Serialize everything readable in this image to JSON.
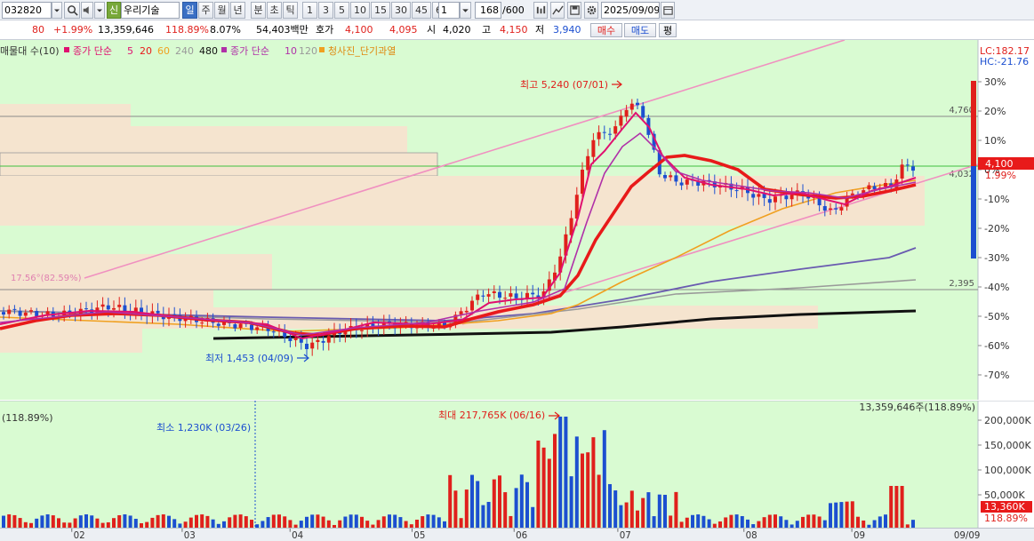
{
  "toolbar": {
    "code": "032820",
    "badge": "신",
    "name": "우리기술",
    "periods": [
      "일",
      "주",
      "월",
      "년",
      "분",
      "초",
      "틱"
    ],
    "numbers": [
      "1",
      "3",
      "5",
      "10",
      "15",
      "30",
      "45",
      "60"
    ],
    "unit": "1",
    "count": "168",
    "count_total": "/600",
    "date": "2025/09/09"
  },
  "quote": {
    "change_abs": "80",
    "change_pct": "+1.99%",
    "volume": "13,359,646",
    "volume_ratio": "118.89%",
    "turnover": "8.07%",
    "amount": "54,403백만",
    "quote_label": "호가",
    "ask": "4,100",
    "bid": "4,095",
    "open_label": "시",
    "open": "4,020",
    "high_label": "고",
    "high": "4,150",
    "low_label": "저",
    "low": "3,940",
    "buy_label": "매수",
    "sell_label": "매도",
    "eval_label": "평"
  },
  "legend": {
    "item1": "매물대 수(10)",
    "item2_label": "종가 단순",
    "item2_p1": "5",
    "item2_p2": "20",
    "item2_p3": "60",
    "item2_p4": "240",
    "item2_p5": "480",
    "item3_label": "종가 단순",
    "item3_p1": "10",
    "item3_p2": "120",
    "item4": "청사진_단기과열"
  },
  "price_axis": {
    "lc": "LC:182.17",
    "hc": "HC:-21.76",
    "ticks": [
      "30%",
      "20%",
      "10%",
      "0%",
      "-10%",
      "-20%",
      "-30%",
      "-40%",
      "-50%",
      "-60%",
      "-70%"
    ],
    "current_price": "4,100",
    "current_pct": "1.99%"
  },
  "annotations": {
    "high_label": "최고 5,240 (07/01)",
    "low_label": "최저 1,453 (04/09)",
    "level_4760": "4,760",
    "level_4032": "4,032",
    "level_2395": "2,395",
    "trend_label": "17.56°(82.59%)"
  },
  "volume": {
    "left_label": "(118.89%)",
    "right_label": "13,359,646주(118.89%)",
    "max_label": "최대 217,765K (06/16)",
    "min_label": "최소 1,230K (03/26)",
    "ticks": [
      "200,000K",
      "150,000K",
      "100,000K",
      "50,000K"
    ],
    "current": "13,360K",
    "current_pct": "118.89%"
  },
  "xaxis": {
    "months": [
      "02",
      "03",
      "04",
      "05",
      "06",
      "07",
      "08",
      "09"
    ],
    "right_date": "09/09"
  },
  "colors": {
    "bg_plot": "#d9fbd2",
    "up": "#e0201c",
    "down": "#1c4fd0",
    "ma5": "#e01070",
    "ma20": "#e81a1a",
    "ma60": "#f0a020",
    "ma240": "#6a5bb0",
    "ma480": "#111111",
    "ma120": "#9a9a9a",
    "volume_zone": "#f5e4cf"
  }
}
